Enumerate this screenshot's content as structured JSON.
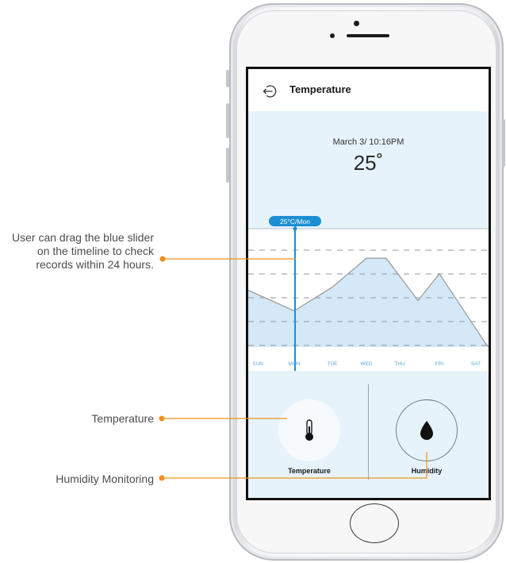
{
  "annotations": {
    "slider_note": "User can drag the blue slider on the timeline to check records within 24 hours.",
    "temperature_note": "Temperature",
    "humidity_note": "Humidity Monitoring"
  },
  "app": {
    "title": "Temperature",
    "back_icon": "back-arrow-icon"
  },
  "reading": {
    "datetime": "March 3/ 10:16PM",
    "temperature": "25˚"
  },
  "chart_data": {
    "type": "area",
    "x": [
      "SUN",
      "MON",
      "TUE",
      "WED",
      "THU",
      "FRI",
      "SAT"
    ],
    "y_points": [
      {
        "x": "SUN",
        "y": 0.55
      },
      {
        "x": "MON",
        "y": 0.35
      },
      {
        "x": "TUE",
        "y": 0.58
      },
      {
        "x": "WED",
        "y": 0.86
      },
      {
        "x": "WED-THU",
        "y": 0.86
      },
      {
        "x": "THU-FRI",
        "y": 0.45
      },
      {
        "x": "FRI",
        "y": 0.71
      },
      {
        "x": "SAT",
        "y": 0.0
      }
    ],
    "slider": {
      "position": "MON",
      "label": "25°C/Mon"
    },
    "gridlines": 5,
    "line_color": "#9e9e9e",
    "fill_color": "#cfe6f6",
    "slider_color": "#1b8fd4"
  },
  "controls": {
    "temperature_label": "Temperature",
    "humidity_label": "Humidity",
    "temperature_icon": "thermometer-icon",
    "humidity_icon": "water-drop-icon"
  },
  "colors": {
    "accent_orange": "#f0911e",
    "panel_bg": "#e7f3fb",
    "slider_blue": "#1b8fd4"
  }
}
